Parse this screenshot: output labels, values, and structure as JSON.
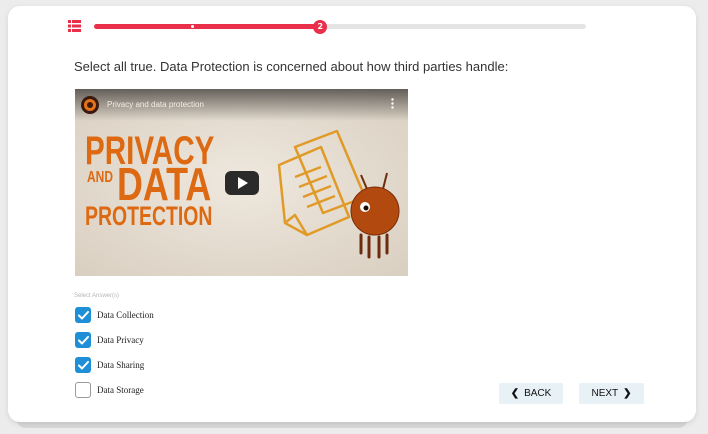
{
  "progress": {
    "current_step": "2",
    "fraction": 0.46
  },
  "question": {
    "text": "Select all true. Data Protection is concerned about how third parties handle:"
  },
  "video": {
    "title": "Privacy and data protection",
    "text_line1": "PRIVACY",
    "text_line2a": "AND",
    "text_line2b": "DATA",
    "text_line3": "PROTECTION",
    "accent_color": "#dd6a12"
  },
  "answers": {
    "label": "Select Answer(s)",
    "options": [
      {
        "label": "Data Collection",
        "checked": true
      },
      {
        "label": "Data Privacy",
        "checked": true
      },
      {
        "label": "Data Sharing",
        "checked": true
      },
      {
        "label": "Data Storage",
        "checked": false
      }
    ]
  },
  "nav": {
    "back_label": "BACK",
    "next_label": "NEXT",
    "back_icon": "chevron-left-icon",
    "next_icon": "chevron-right-icon"
  },
  "colors": {
    "progress": "#ea2f4b",
    "checkbox": "#1e8fd6",
    "button_bg": "#e7f1f6"
  }
}
